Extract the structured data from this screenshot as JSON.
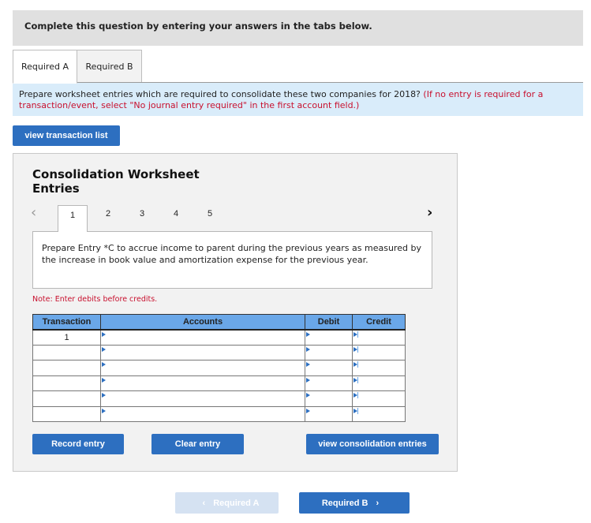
{
  "header": {
    "instruction": "Complete this question by entering your answers in the tabs below."
  },
  "tabs": [
    {
      "label": "Required A",
      "active": true
    },
    {
      "label": "Required B",
      "active": false
    }
  ],
  "question": {
    "text": "Prepare worksheet entries which are required to consolidate these two companies for 2018?",
    "note": "(If no entry is required for a transaction/event, select \"No journal entry required\" in the first account field.)"
  },
  "buttons": {
    "view_transaction_list": "view transaction list",
    "record_entry": "Record entry",
    "clear_entry": "Clear entry",
    "view_consolidation_entries": "view consolidation entries",
    "prev_required": "Required A",
    "next_required": "Required B"
  },
  "worksheet": {
    "title": "Consolidation Worksheet Entries",
    "pages": [
      "1",
      "2",
      "3",
      "4",
      "5"
    ],
    "active_page": "1",
    "prev_icon": "‹",
    "next_icon": "›",
    "prompt": "Prepare Entry *C to accrue income to parent during the previous years as measured by the increase in book value and amortization expense for the previous year.",
    "note": "Note: Enter debits before credits.",
    "columns": {
      "transaction": "Transaction",
      "accounts": "Accounts",
      "debit": "Debit",
      "credit": "Credit"
    },
    "rows": [
      {
        "transaction": "1",
        "account": "",
        "debit": "",
        "credit": ""
      },
      {
        "transaction": "",
        "account": "",
        "debit": "",
        "credit": ""
      },
      {
        "transaction": "",
        "account": "",
        "debit": "",
        "credit": ""
      },
      {
        "transaction": "",
        "account": "",
        "debit": "",
        "credit": ""
      },
      {
        "transaction": "",
        "account": "",
        "debit": "",
        "credit": ""
      },
      {
        "transaction": "",
        "account": "",
        "debit": "",
        "credit": ""
      }
    ]
  },
  "nav": {
    "prev_chevron": "‹",
    "next_chevron": "›"
  },
  "colors": {
    "primary_button": "#2d6fc0",
    "disabled_button": "#d5e2f2",
    "table_header": "#6aa7e8",
    "instruction_bg": "#d9ecfa",
    "error_red": "#c8102e"
  }
}
